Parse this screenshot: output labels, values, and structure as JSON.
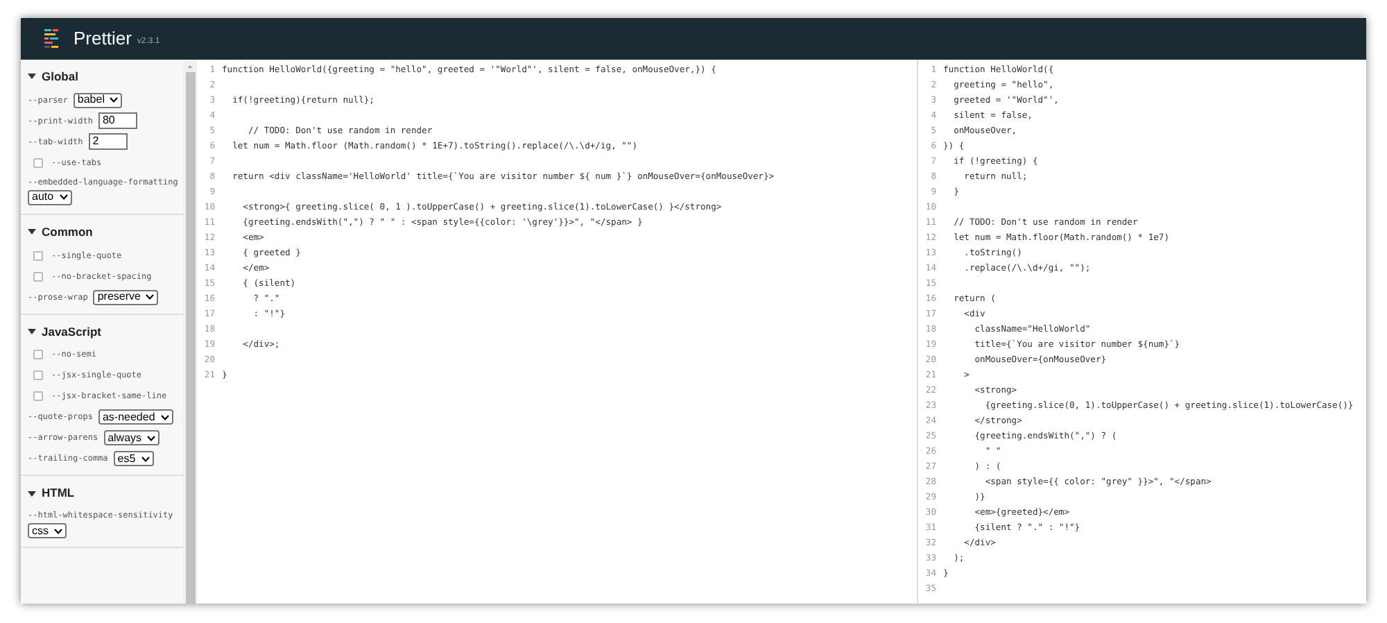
{
  "header": {
    "title": "Prettier",
    "version": "v2.3.1"
  },
  "sidebar": {
    "sections": [
      {
        "title": "Global",
        "expanded": true,
        "options": [
          {
            "kind": "select",
            "label": "--parser",
            "value": "babel"
          },
          {
            "kind": "number",
            "label": "--print-width",
            "value": "80"
          },
          {
            "kind": "number",
            "label": "--tab-width",
            "value": "2"
          },
          {
            "kind": "checkbox",
            "label": "--use-tabs",
            "checked": false
          },
          {
            "kind": "select-wrap",
            "label": "--embedded-language-formatting",
            "value": "auto"
          }
        ]
      },
      {
        "title": "Common",
        "expanded": true,
        "options": [
          {
            "kind": "checkbox",
            "label": "--single-quote",
            "checked": false
          },
          {
            "kind": "checkbox",
            "label": "--no-bracket-spacing",
            "checked": false
          },
          {
            "kind": "select",
            "label": "--prose-wrap",
            "value": "preserve"
          }
        ]
      },
      {
        "title": "JavaScript",
        "expanded": true,
        "options": [
          {
            "kind": "checkbox",
            "label": "--no-semi",
            "checked": false
          },
          {
            "kind": "checkbox",
            "label": "--jsx-single-quote",
            "checked": false
          },
          {
            "kind": "checkbox",
            "label": "--jsx-bracket-same-line",
            "checked": false
          },
          {
            "kind": "select",
            "label": "--quote-props",
            "value": "as-needed"
          },
          {
            "kind": "select",
            "label": "--arrow-parens",
            "value": "always"
          },
          {
            "kind": "select",
            "label": "--trailing-comma",
            "value": "es5"
          }
        ]
      },
      {
        "title": "HTML",
        "expanded": true,
        "options": [
          {
            "kind": "select-wrap",
            "label": "--html-whitespace-sensitivity",
            "value": "css"
          }
        ]
      }
    ]
  },
  "input": {
    "lines": [
      {
        "n": "1",
        "code": "function HelloWorld({greeting = \"hello\", greeted = '\"World\"', silent = false, onMouseOver,}) {"
      },
      {
        "n": "2"
      },
      {
        "n": "3",
        "code": "  if(!greeting){return null};"
      },
      {
        "n": "4"
      },
      {
        "n": "5",
        "code": "     // TODO: Don't use random in render"
      },
      {
        "n": "6",
        "code": "  let num = Math.floor (Math.random() * 1E+7).toString().replace(/\\.\\d+/ig, \"\")"
      },
      {
        "n": "7"
      },
      {
        "n": "8",
        "code": "  return <div className='HelloWorld' title={`You are visitor number ${ num }`} onMouseOver={onMouseOver}>"
      },
      {
        "n": "9"
      },
      {
        "n": "10",
        "code": "    <strong>{ greeting.slice( 0, 1 ).toUpperCase() + greeting.slice(1).toLowerCase() }</strong>"
      },
      {
        "n": "11",
        "code": "    {greeting.endsWith(\",\") ? \" \" : <span style={{color: '\\grey'}}>\", \"</span> }"
      },
      {
        "n": "12",
        "code": "    <em>"
      },
      {
        "n": "13",
        "code": "    { greeted }"
      },
      {
        "n": "14",
        "code": "    </em>"
      },
      {
        "n": "15",
        "code": "    { (silent)"
      },
      {
        "n": "16",
        "code": "      ? \".\""
      },
      {
        "n": "17",
        "code": "      : \"!\"}"
      },
      {
        "n": "18"
      },
      {
        "n": "19",
        "code": "    </div>;"
      },
      {
        "n": "20"
      },
      {
        "n": "21",
        "code": "}"
      }
    ]
  },
  "output": {
    "lines": [
      {
        "n": "1",
        "code": "function HelloWorld({"
      },
      {
        "n": "2",
        "code": "  greeting = \"hello\","
      },
      {
        "n": "3",
        "code": "  greeted = '\"World\"',"
      },
      {
        "n": "4",
        "code": "  silent = false,"
      },
      {
        "n": "5",
        "code": "  onMouseOver,"
      },
      {
        "n": "6",
        "code": "}) {"
      },
      {
        "n": "7",
        "code": "  if (!greeting) {"
      },
      {
        "n": "8",
        "code": "    return null;"
      },
      {
        "n": "9",
        "code": "  }"
      },
      {
        "n": "10"
      },
      {
        "n": "11",
        "code": "  // TODO: Don't use random in render"
      },
      {
        "n": "12",
        "code": "  let num = Math.floor(Math.random() * 1e7)"
      },
      {
        "n": "13",
        "code": "    .toString()"
      },
      {
        "n": "14",
        "code": "    .replace(/\\.\\d+/gi, \"\");"
      },
      {
        "n": "15"
      },
      {
        "n": "16",
        "code": "  return ("
      },
      {
        "n": "17",
        "code": "    <div"
      },
      {
        "n": "18",
        "code": "      className=\"HelloWorld\""
      },
      {
        "n": "19",
        "code": "      title={`You are visitor number ${num}`}"
      },
      {
        "n": "20",
        "code": "      onMouseOver={onMouseOver}"
      },
      {
        "n": "21",
        "code": "    >"
      },
      {
        "n": "22",
        "code": "      <strong>"
      },
      {
        "n": "23",
        "code": "        {greeting.slice(0, 1).toUpperCase() + greeting.slice(1).toLowerCase()}"
      },
      {
        "n": "24",
        "code": "      </strong>"
      },
      {
        "n": "25",
        "code": "      {greeting.endsWith(\",\") ? ("
      },
      {
        "n": "26",
        "code": "        \" \""
      },
      {
        "n": "27",
        "code": "      ) : ("
      },
      {
        "n": "28",
        "code": "        <span style={{ color: \"grey\" }}>\", \"</span>"
      },
      {
        "n": "29",
        "code": "      )}"
      },
      {
        "n": "30",
        "code": "      <em>{greeted}</em>"
      },
      {
        "n": "31",
        "code": "      {silent ? \".\" : \"!\"}"
      },
      {
        "n": "32",
        "code": "    </div>"
      },
      {
        "n": "33",
        "code": "  );"
      },
      {
        "n": "34",
        "code": "}"
      },
      {
        "n": "35"
      }
    ]
  }
}
